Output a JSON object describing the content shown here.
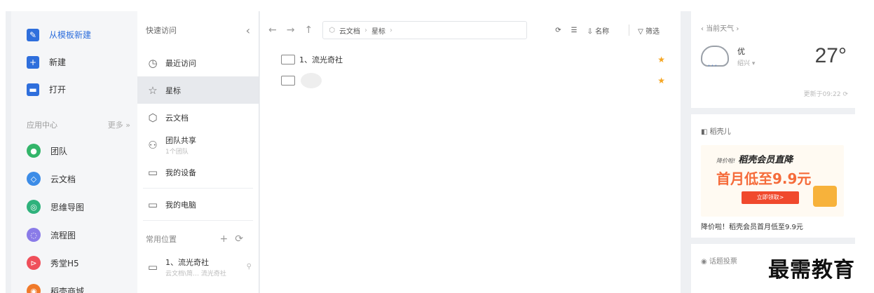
{
  "nav": {
    "primary": [
      {
        "label": "从模板新建",
        "icon": "template-new-icon",
        "color": "#2f6fdc"
      },
      {
        "label": "新建",
        "icon": "plus-icon",
        "color": "#2f6fdc"
      },
      {
        "label": "打开",
        "icon": "folder-open-icon",
        "color": "#2f6fdc"
      }
    ],
    "section_title": "应用中心",
    "more_label": "更多 »",
    "apps": [
      {
        "label": "团队",
        "icon": "team-icon",
        "color": "#33b56a"
      },
      {
        "label": "云文档",
        "icon": "cloud-doc-icon",
        "color": "#3c8ce7"
      },
      {
        "label": "思维导图",
        "icon": "mindmap-icon",
        "color": "#2fb27c"
      },
      {
        "label": "流程图",
        "icon": "flowchart-icon",
        "color": "#8a7be8"
      },
      {
        "label": "秀堂H5",
        "icon": "h5-icon",
        "color": "#ef4f5a"
      },
      {
        "label": "稻壳商城",
        "icon": "store-icon",
        "color": "#f07a2a"
      }
    ]
  },
  "quick": {
    "title": "快速访问",
    "items": [
      {
        "label": "最近访问",
        "icon": "clock-icon"
      },
      {
        "label": "星标",
        "icon": "star-outline-icon"
      },
      {
        "label": "云文档",
        "icon": "cube-icon"
      },
      {
        "label": "团队共享",
        "sub": "1个团队",
        "icon": "team-share-icon"
      },
      {
        "label": "我的设备",
        "icon": "devices-icon"
      },
      {
        "label": "我的电脑",
        "icon": "monitor-icon"
      }
    ],
    "common_title": "常用位置",
    "common_item": {
      "label": "1、流光奇社",
      "sub": "云文档\\简…  流光奇社"
    }
  },
  "main": {
    "path": [
      "云文档",
      "星标"
    ],
    "sort_label": "名称",
    "filter_label": "筛选",
    "files": [
      {
        "name": "1、流光奇社",
        "starred": true
      },
      {
        "name": "",
        "starred": true
      }
    ]
  },
  "weather": {
    "title": "当前天气",
    "quality": "优",
    "city": "绍兴 ▾",
    "temp": "27°",
    "updated": "更新于09:22"
  },
  "daoke": {
    "title": "稻壳儿",
    "ad_line1_prefix": "降价啦!",
    "ad_line1": "稻壳会员直降",
    "ad_line2": "首月低至9.9元",
    "ad_button": "立即领取>",
    "caption": "降价啦！稻壳会员首月低至9.9元"
  },
  "topic": {
    "title": "话题投票"
  },
  "watermark": "最需教育"
}
